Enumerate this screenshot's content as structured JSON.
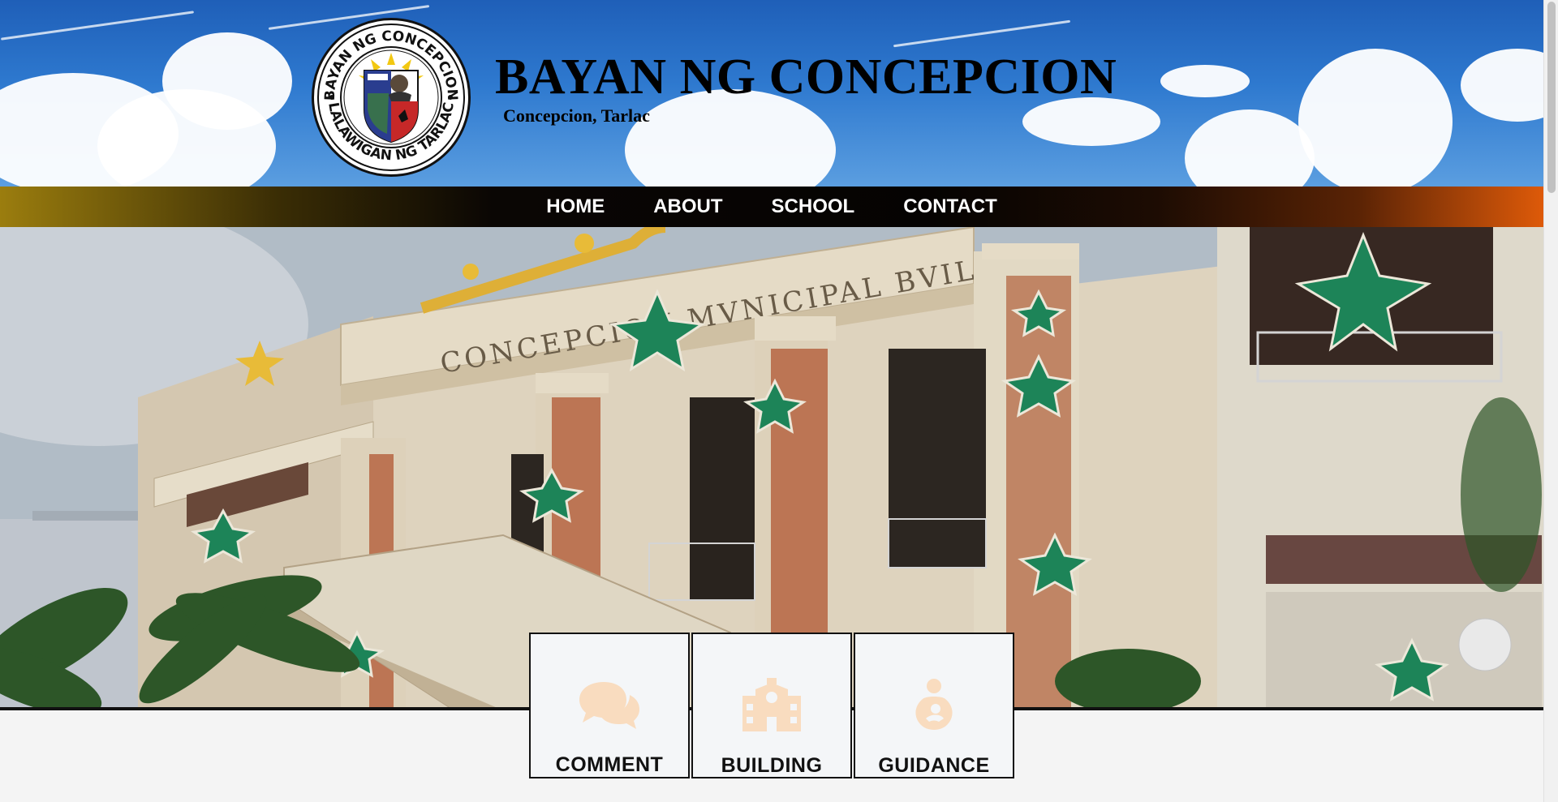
{
  "header": {
    "title": "BAYAN NG CONCEPCION",
    "subtitle": "Concepcion, Tarlac",
    "seal": {
      "top_text": "BAYAN NG CONCEPCION",
      "bottom_text": "LALAWIGAN NG TARLAC"
    }
  },
  "nav": {
    "items": [
      {
        "label": "HOME"
      },
      {
        "label": "ABOUT"
      },
      {
        "label": "SCHOOL"
      },
      {
        "label": "CONTACT"
      }
    ]
  },
  "hero": {
    "building_sign": "CONCEPCION MVNICIPAL BVILDING"
  },
  "cards": [
    {
      "label": "COMMENT",
      "icon": "comments-icon"
    },
    {
      "label": "BUILDING",
      "icon": "school-icon"
    },
    {
      "label": "GUIDANCE",
      "icon": "person-holding-child-icon"
    }
  ],
  "colors": {
    "nav_gradient_start": "#9b7d0e",
    "nav_gradient_end": "#de5a09",
    "icon_peach": "#f9dcbf",
    "card_bg": "#f4f6f8"
  }
}
